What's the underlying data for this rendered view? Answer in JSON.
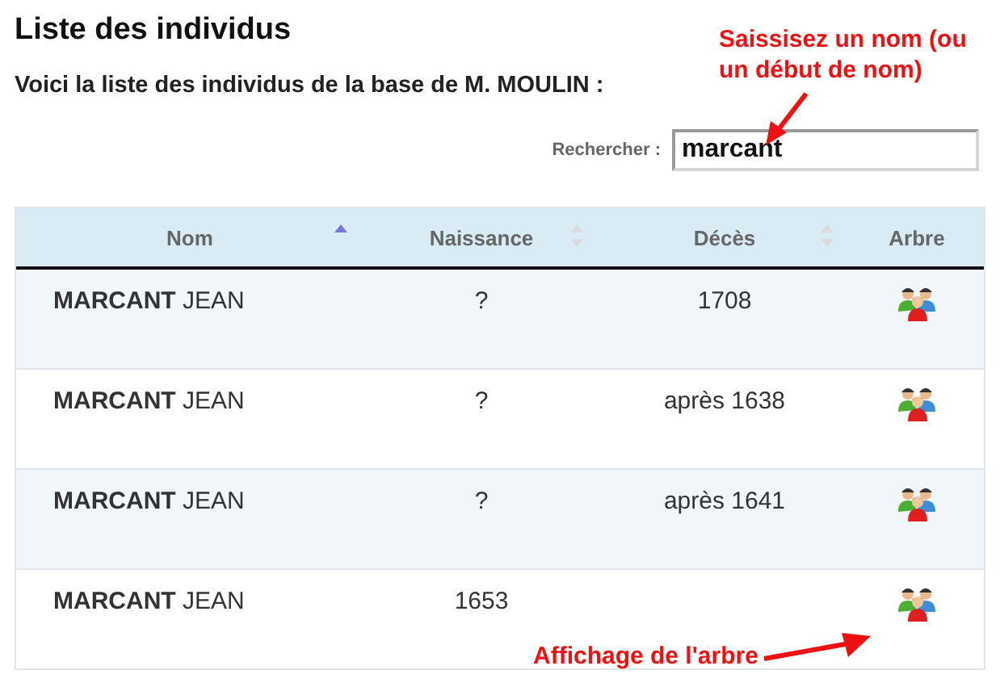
{
  "title": "Liste des individus",
  "subtitle": "Voici la liste des individus de la base de M. MOULIN :",
  "search": {
    "label": "Rechercher :",
    "value": "marcant"
  },
  "table": {
    "columns": [
      {
        "label": "Nom",
        "sorted": true
      },
      {
        "label": "Naissance",
        "sorted": false
      },
      {
        "label": "Décès",
        "sorted": false
      },
      {
        "label": "Arbre"
      }
    ],
    "rows": [
      {
        "surname": "MARCANT",
        "given": "JEAN",
        "birth": "?",
        "death": "1708"
      },
      {
        "surname": "MARCANT",
        "given": "JEAN",
        "birth": "?",
        "death": "après 1638"
      },
      {
        "surname": "MARCANT",
        "given": "JEAN",
        "birth": "?",
        "death": "après 1641"
      },
      {
        "surname": "MARCANT",
        "given": "JEAN",
        "birth": "1653"
      }
    ]
  },
  "annotations": [
    {
      "kind": "search",
      "text": "Saissisez un nom (ou un début de nom)"
    },
    {
      "kind": "tree",
      "text": "Affichage de l'arbre"
    }
  ]
}
